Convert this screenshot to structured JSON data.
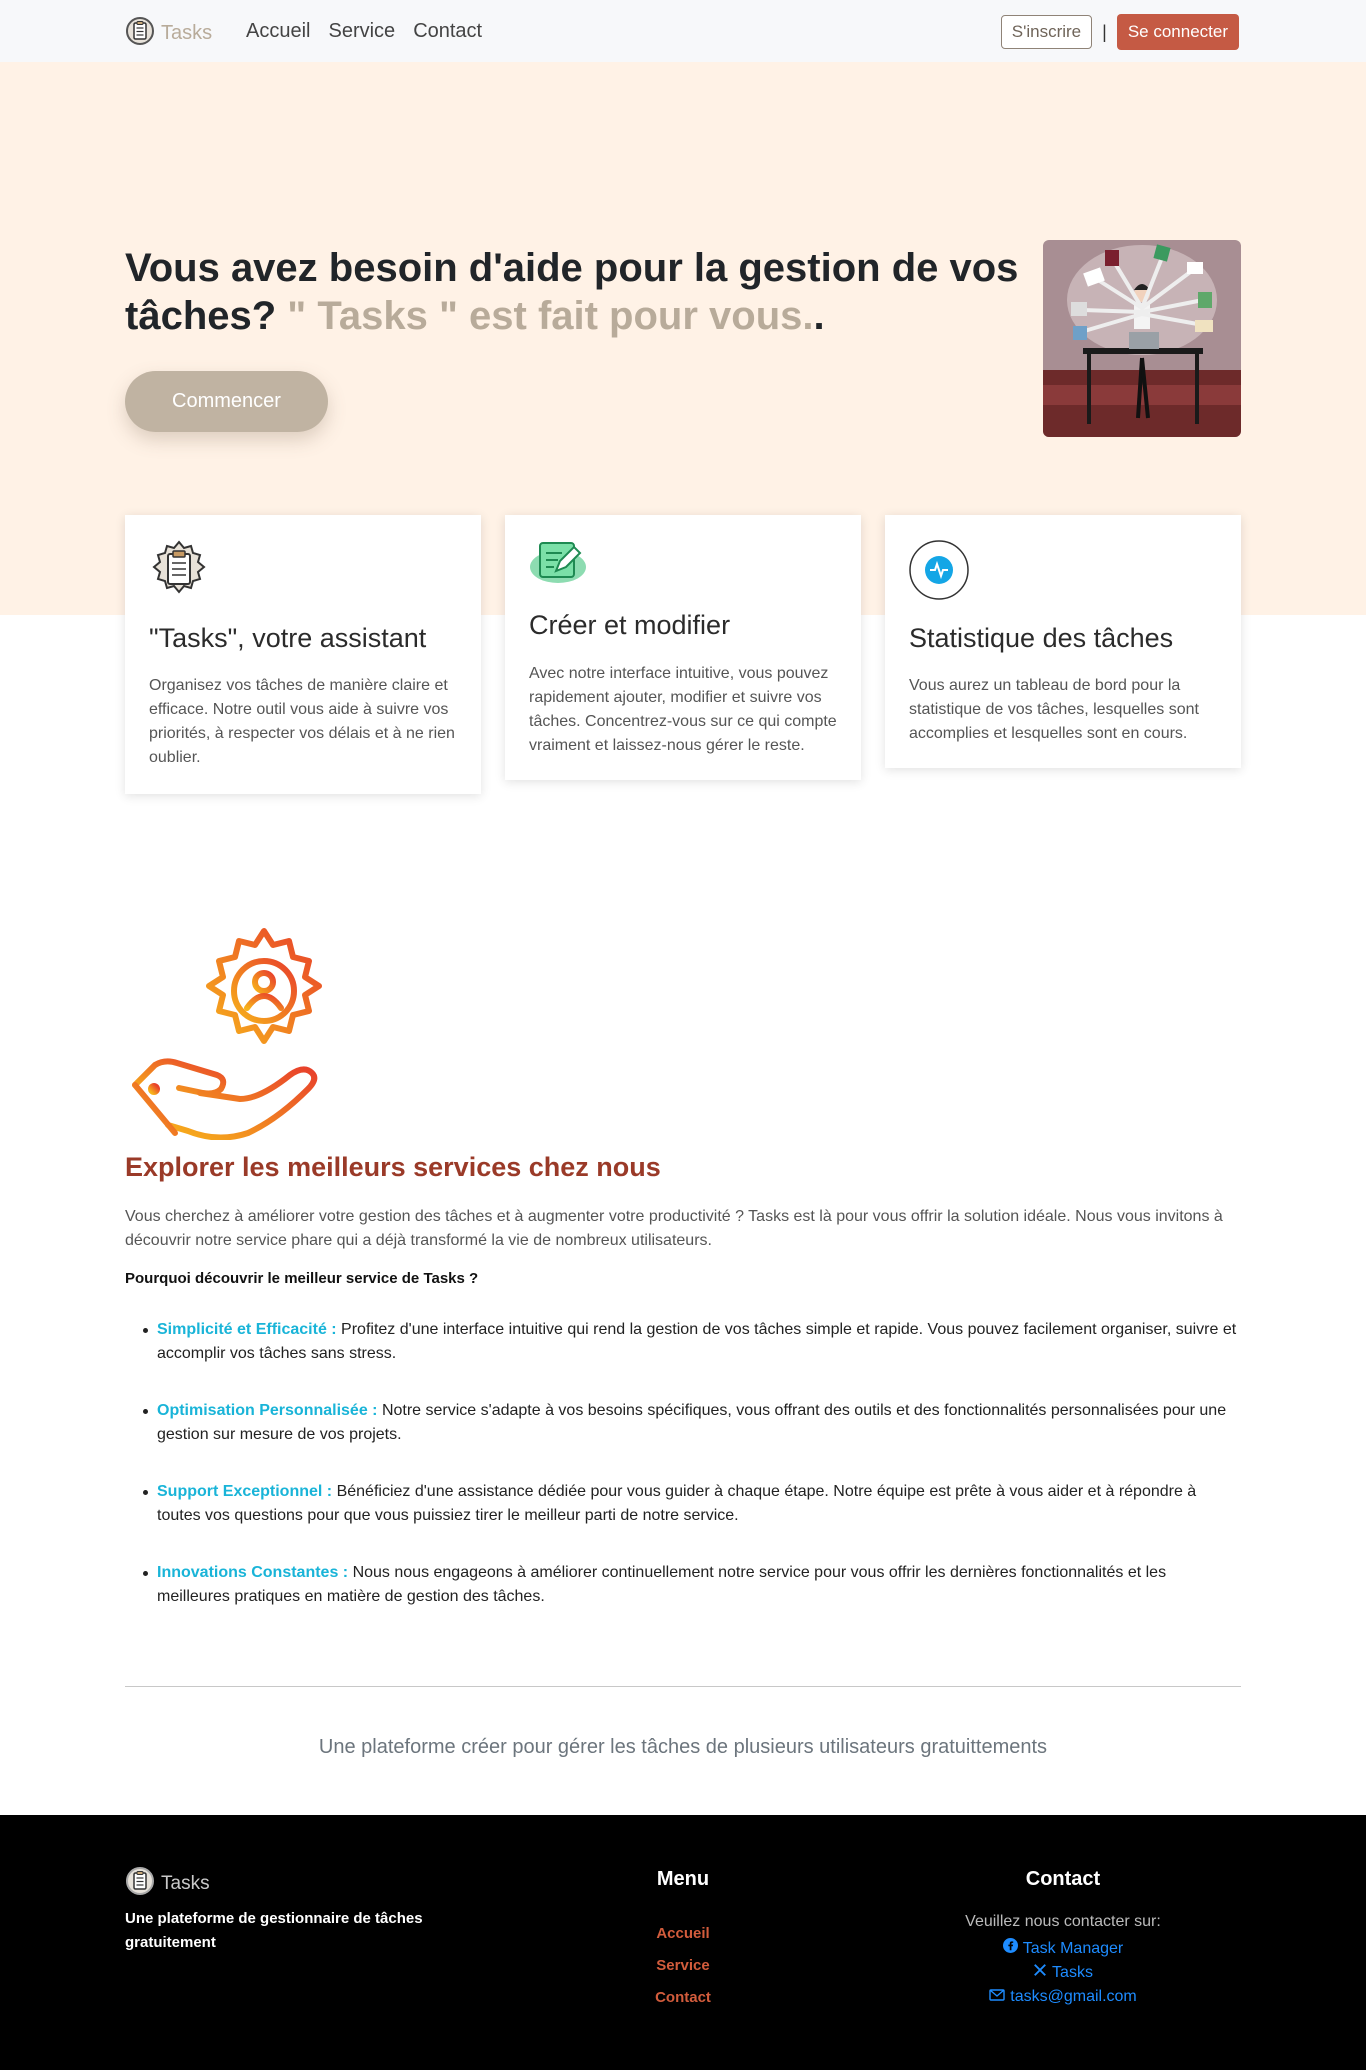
{
  "nav": {
    "brand": "Tasks",
    "links": [
      "Accueil",
      "Service",
      "Contact"
    ],
    "signup_label": "S'inscrire",
    "separator": "|",
    "login_label": "Se connecter"
  },
  "hero": {
    "title_main": "Vous avez besoin d'aide pour la gestion de vos tâches?",
    "title_accent": "\" Tasks \" est fait pour vous.",
    "title_end": ".",
    "cta_label": "Commencer"
  },
  "cards": [
    {
      "icon": "clipboard-gear-icon",
      "title": "\"Tasks\", votre assistant",
      "text": "Organisez vos tâches de manière claire et efficace. Notre outil vous aide à suivre vos priorités, à respecter vos délais et à ne rien oublier."
    },
    {
      "icon": "edit-note-icon",
      "title": "Créer et modifier",
      "text": "Avec notre interface intuitive, vous pouvez rapidement ajouter, modifier et suivre vos tâches. Concentrez-vous sur ce qui compte vraiment et laissez-nous gérer le reste."
    },
    {
      "icon": "pulse-stats-icon",
      "title": "Statistique des tâches",
      "text": "Vous aurez un tableau de bord pour la statistique de vos tâches, lesquelles sont accomplies et lesquelles sont en cours."
    }
  ],
  "services": {
    "title_pre": "Explorer les meilleurs ",
    "title_bold": "services",
    "title_post": " chez nous",
    "intro": "Vous cherchez à améliorer votre gestion des tâches et à augmenter votre productivité ? Tasks est là pour vous offrir la solution idéale. Nous vous invitons à découvrir notre service phare qui a déjà transformé la vie de nombreux utilisateurs.",
    "question": "Pourquoi découvrir le meilleur service de Tasks ?",
    "items": [
      {
        "title": "Simplicité et Efficacité :",
        "text": " Profitez d'une interface intuitive qui rend la gestion de vos tâches simple et rapide. Vous pouvez facilement organiser, suivre et accomplir vos tâches sans stress."
      },
      {
        "title": "Optimisation Personnalisée :",
        "text": " Notre service s'adapte à vos besoins spécifiques, vous offrant des outils et des fonctionnalités personnalisées pour une gestion sur mesure de vos projets."
      },
      {
        "title": "Support Exceptionnel :",
        "text": " Bénéficiez d'une assistance dédiée pour vous guider à chaque étape. Notre équipe est prête à vous aider et à répondre à toutes vos questions pour que vous puissiez tirer le meilleur parti de notre service."
      },
      {
        "title": "Innovations Constantes :",
        "text": " Nous nous engageons à améliorer continuellement notre service pour vous offrir les dernières fonctionnalités et les meilleures pratiques en matière de gestion des tâches."
      }
    ]
  },
  "tagline": "Une plateforme créer pour gérer les tâches de plusieurs utilisateurs gratuittements",
  "footer": {
    "brand": "Tasks",
    "description": "Une plateforme de gestionnaire de tâches gratuitement",
    "menu_title": "Menu",
    "menu_links": [
      "Accueil",
      "Service",
      "Contact"
    ],
    "contact_title": "Contact",
    "contact_intro": "Veuillez nous contacter sur:",
    "contact_links": [
      {
        "icon": "facebook-icon",
        "label": "Task Manager"
      },
      {
        "icon": "x-icon",
        "label": "Tasks"
      },
      {
        "icon": "envelope-icon",
        "label": "tasks@gmail.com"
      }
    ]
  },
  "colors": {
    "hero_bg": "#fff2e6",
    "accent_beige": "#b8ab9a",
    "login_red": "#c55a44",
    "services_title": "#9a3a28",
    "feature_cyan": "#19b4d8",
    "footer_link": "#d25c3c",
    "contact_link": "#1e8cff"
  }
}
